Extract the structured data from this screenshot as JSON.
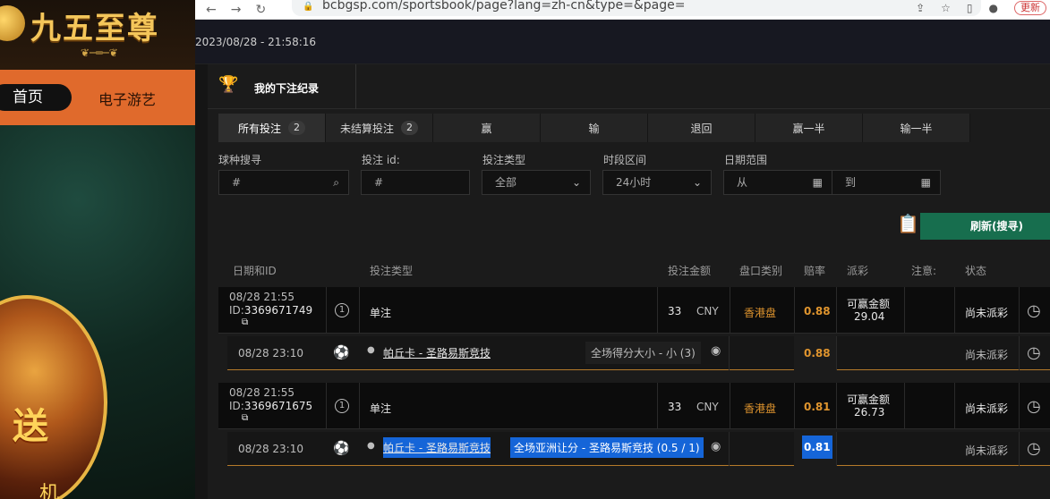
{
  "browser": {
    "url": "bcbgsp.com/sportsbook/page?lang=zh-cn&type=&page=",
    "update_label": "更新"
  },
  "site": {
    "brand": "九五至尊",
    "menu": {
      "home": "首页",
      "games": "电子游艺"
    },
    "promo": {
      "line1": "送",
      "line2": "机"
    }
  },
  "app": {
    "timestamp": "2023/08/28 - 21:58:16",
    "panel_title": "我的下注纪录",
    "tabs": [
      {
        "label": "所有投注",
        "count": "2"
      },
      {
        "label": "未结算投注",
        "count": "2"
      },
      {
        "label": "赢"
      },
      {
        "label": "输"
      },
      {
        "label": "退回"
      },
      {
        "label": "赢一半"
      },
      {
        "label": "输一半"
      }
    ],
    "filters": {
      "sport_search": {
        "label": "球种搜寻",
        "placeholder": "#"
      },
      "bet_id": {
        "label": "投注 id:",
        "placeholder": "#"
      },
      "bet_type": {
        "label": "投注类型",
        "value": "全部"
      },
      "time_range": {
        "label": "时段区间",
        "value": "24小时"
      },
      "date_range": {
        "label": "日期范围",
        "from": "从",
        "to": "到"
      }
    },
    "refresh_label": "刷新(搜寻)",
    "columns": [
      "日期和ID",
      "投注类型",
      "投注金额",
      "盘口类别",
      "赔率",
      "派彩",
      "注意:",
      "状态"
    ],
    "bets": [
      {
        "date": "08/28 21:55",
        "id_prefix": "ID:",
        "id": "3369671749",
        "bet_number": "1",
        "type": "单注",
        "amount": "33",
        "currency": "CNY",
        "market": "香港盘",
        "odds": "0.88",
        "payout_label": "可赢金额",
        "payout": "29.04",
        "status": "尚未派彩",
        "leg": {
          "time": "08/28 23:10",
          "match": "帕丘卡 - 圣路易斯竞技",
          "selection": "全场得分大小 - 小 (3)",
          "odds": "0.88",
          "status": "尚未派彩"
        }
      },
      {
        "date": "08/28 21:55",
        "id_prefix": "ID:",
        "id": "3369671675",
        "bet_number": "1",
        "type": "单注",
        "amount": "33",
        "currency": "CNY",
        "market": "香港盘",
        "odds": "0.81",
        "payout_label": "可赢金额",
        "payout": "26.73",
        "status": "尚未派彩",
        "leg": {
          "time": "08/28 23:10",
          "match": "帕丘卡 - 圣路易斯竞技",
          "selection": "全场亚洲让分 - 圣路易斯竞技 (0.5 / 1)",
          "odds": "0.81",
          "status": "尚未派彩"
        }
      }
    ]
  },
  "colors": {
    "accent": "#e0952e",
    "refresh": "#176e4e",
    "selection": "#1565d8"
  }
}
